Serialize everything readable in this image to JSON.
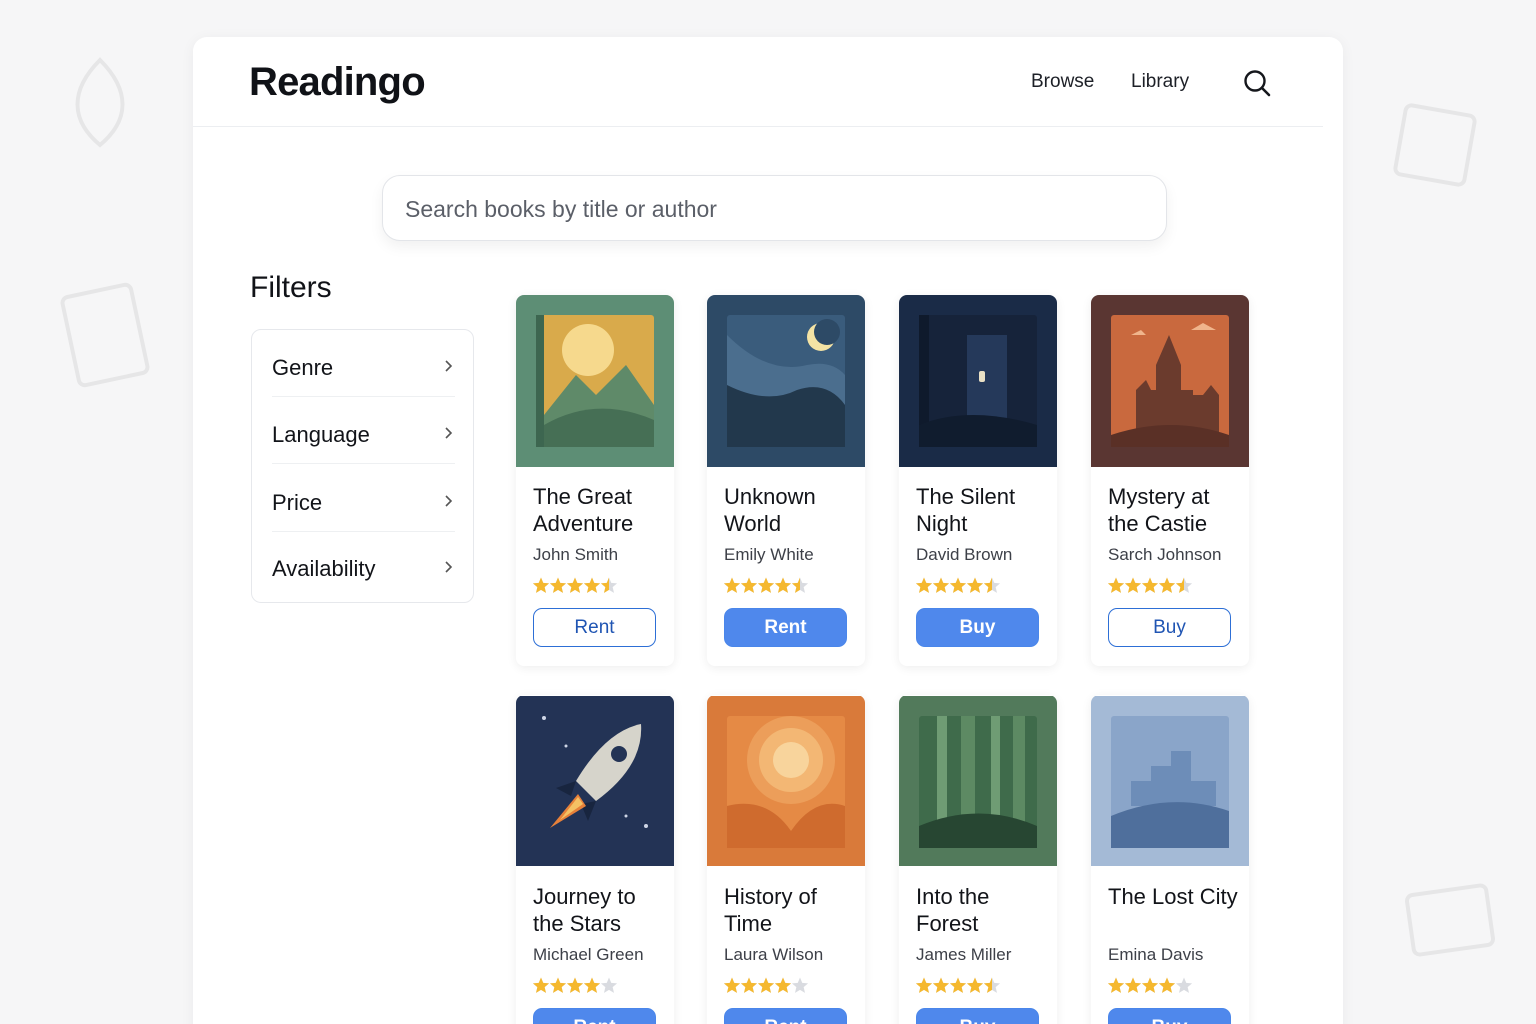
{
  "app": {
    "name": "Readingo"
  },
  "nav": {
    "browse": "Browse",
    "library": "Library",
    "search_icon": "search-icon"
  },
  "search": {
    "placeholder": "Search books by title or author",
    "value": ""
  },
  "filters": {
    "title": "Filters",
    "items": [
      {
        "label": "Genre"
      },
      {
        "label": "Language"
      },
      {
        "label": "Price"
      },
      {
        "label": "Availability"
      }
    ]
  },
  "colors": {
    "accent": "#4f88ec",
    "accent_dark": "#2055b3",
    "star": "#f5b82e",
    "star_empty": "#d9dbe0"
  },
  "books": [
    {
      "title": "The Great Adventure",
      "author": "John Smith",
      "rating": 4.5,
      "action": "Rent",
      "style": "outline",
      "cover": "mountain-sun"
    },
    {
      "title": "Unknown World",
      "author": "Emily White",
      "rating": 4.5,
      "action": "Rent",
      "style": "solid",
      "cover": "night-hills-moon"
    },
    {
      "title": "The Silent Night",
      "author": "David Brown",
      "rating": 4.5,
      "action": "Buy",
      "style": "solid",
      "cover": "dark-tower"
    },
    {
      "title": "Mystery at the Castie",
      "author": "Sarch Johnson",
      "rating": 4.5,
      "action": "Buy",
      "style": "outline",
      "cover": "castle"
    },
    {
      "title": "Journey to the Stars",
      "author": "Michael Green",
      "rating": 4,
      "action": "Rent",
      "style": "solid",
      "cover": "rocket"
    },
    {
      "title": "History of Time",
      "author": "Laura Wilson",
      "rating": 4,
      "action": "Rent",
      "style": "solid",
      "cover": "sunburst"
    },
    {
      "title": "Into the Forest",
      "author": "James Miller",
      "rating": 4.5,
      "action": "Buy",
      "style": "solid",
      "cover": "forest"
    },
    {
      "title": "The Lost City",
      "author": "Emina Davis",
      "rating": 4,
      "action": "Buy",
      "style": "solid",
      "cover": "city-ruins"
    }
  ]
}
